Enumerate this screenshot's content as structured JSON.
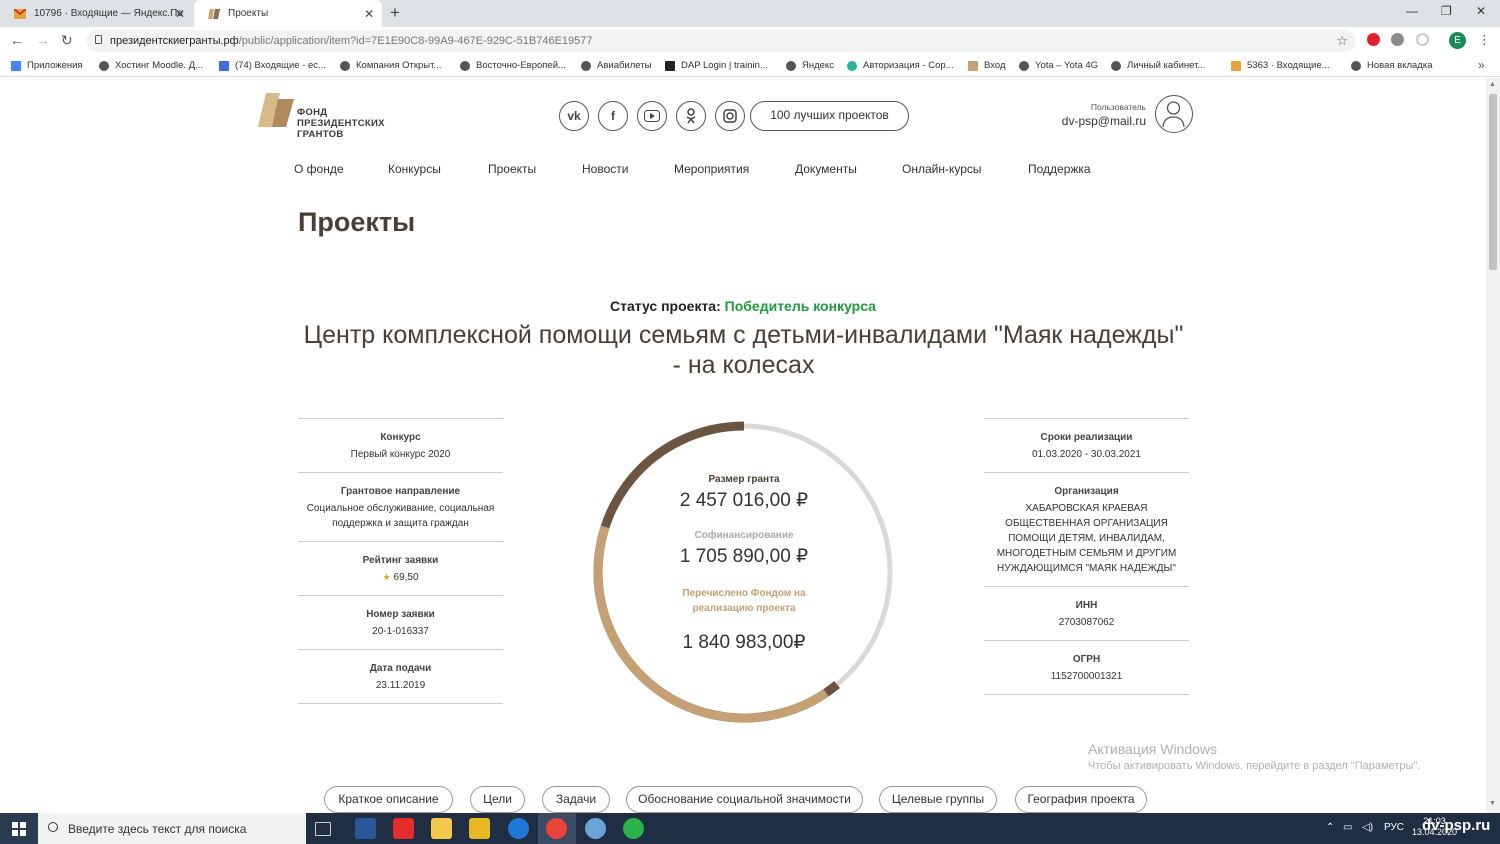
{
  "browser": {
    "tabs": [
      {
        "title": "10796 · Входящие — Яндекс.По",
        "active": false
      },
      {
        "title": "Проекты",
        "active": true
      }
    ],
    "url_host": "президентскиегранты.рф",
    "url_path": "/public/application/item?id=7E1E90C8-99A9-467E-929C-51B746E19577",
    "bookmarks": [
      "Приложения",
      "Хостинг Moodle. Д...",
      "(74) Входящие - ес...",
      "Компания Открыт...",
      "Восточно-Европей...",
      "Авиабилеты",
      "DAP Login | trainin...",
      "Яндекс",
      "Авторизация - Cop...",
      "Вход",
      "Yota – Yota 4G",
      "Личный кабинет...",
      "5363 · Входящие...",
      "Новая вкладка"
    ],
    "profile_letter": "E"
  },
  "header": {
    "logo_lines": [
      "ФОНД",
      "ПРЕЗИДЕНТСКИХ",
      "ГРАНТОВ"
    ],
    "social": [
      "vk-icon",
      "facebook-icon",
      "youtube-icon",
      "odnoklassniki-icon",
      "instagram-icon"
    ],
    "best_projects": "100 лучших проектов",
    "user_label": "Пользователь",
    "user_email": "dv-psp@mail.ru"
  },
  "nav": [
    "О фонде",
    "Конкурсы",
    "Проекты",
    "Новости",
    "Мероприятия",
    "Документы",
    "Онлайн-курсы",
    "Поддержка"
  ],
  "page_title": "Проекты",
  "status": {
    "label": "Статус проекта:",
    "value": "Победитель конкурса"
  },
  "project_title": "Центр комплексной помощи семьям с детьми-инвалидами \"Маяк надежды\" - на колесах",
  "left_info": [
    {
      "label": "Конкурс",
      "value": "Первый конкурс 2020"
    },
    {
      "label": "Грантовое направление",
      "value": "Социальное обслуживание, социальная поддержка и защита граждан"
    },
    {
      "label": "Рейтинг заявки",
      "value": "69,50"
    },
    {
      "label": "Номер заявки",
      "value": "20-1-016337"
    },
    {
      "label": "Дата подачи",
      "value": "23.11.2019"
    }
  ],
  "right_info": [
    {
      "label": "Сроки реализации",
      "value": "01.03.2020 - 30.03.2021"
    },
    {
      "label": "Организация",
      "value": "ХАБАРОВСКАЯ КРАЕВАЯ ОБЩЕСТВЕННАЯ ОРГАНИЗАЦИЯ ПОМОЩИ ДЕТЯМ, ИНВАЛИДАМ, МНОГОДЕТНЫМ СЕМЬЯМ И ДРУГИМ НУЖДАЮЩИМСЯ \"МАЯК НАДЕЖДЫ\""
    },
    {
      "label": "ИНН",
      "value": "2703087062"
    },
    {
      "label": "ОГРН",
      "value": "1152700001321"
    }
  ],
  "finance": {
    "grant_label": "Размер гранта",
    "grant_value": "2 457 016,00 ₽",
    "cofin_label": "Софинансирование",
    "cofin_value": "1 705 890,00 ₽",
    "paid_label": "Перечислено Фондом на реализацию проекта",
    "paid_value": "1 840 983,00₽",
    "colors": {
      "grant": "#6b5540",
      "paid": "#c4a074",
      "track": "#d9d9d9"
    }
  },
  "tabs_bottom": [
    "Краткое описание",
    "Цели",
    "Задачи",
    "Обоснование социальной значимости",
    "Целевые группы",
    "География проекта"
  ],
  "watermark": {
    "title": "Активация Windows",
    "text": "Чтобы активировать Windows, перейдите в раздел \"Параметры\"."
  },
  "taskbar": {
    "search_placeholder": "Введите здесь текст для поиска",
    "lang": "РУС",
    "time": "21:03",
    "date": "13.04.2020",
    "site_watermark": "dv-psp.ru"
  }
}
